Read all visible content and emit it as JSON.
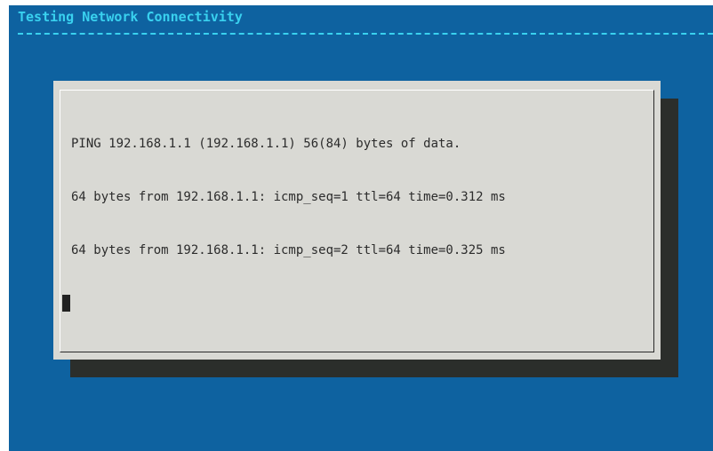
{
  "backtitle": "Testing Network Connectivity",
  "output_lines": [
    "PING 192.168.1.1 (192.168.1.1) 56(84) bytes of data.",
    "64 bytes from 192.168.1.1: icmp_seq=1 ttl=64 time=0.312 ms",
    "64 bytes from 192.168.1.1: icmp_seq=2 ttl=64 time=0.325 ms"
  ],
  "colors": {
    "background": "#0e62a0",
    "backtitle": "#39d1ef",
    "dialog": "#d9d9d4",
    "shadow": "#2b2e2b",
    "text": "#2c2c2c"
  }
}
